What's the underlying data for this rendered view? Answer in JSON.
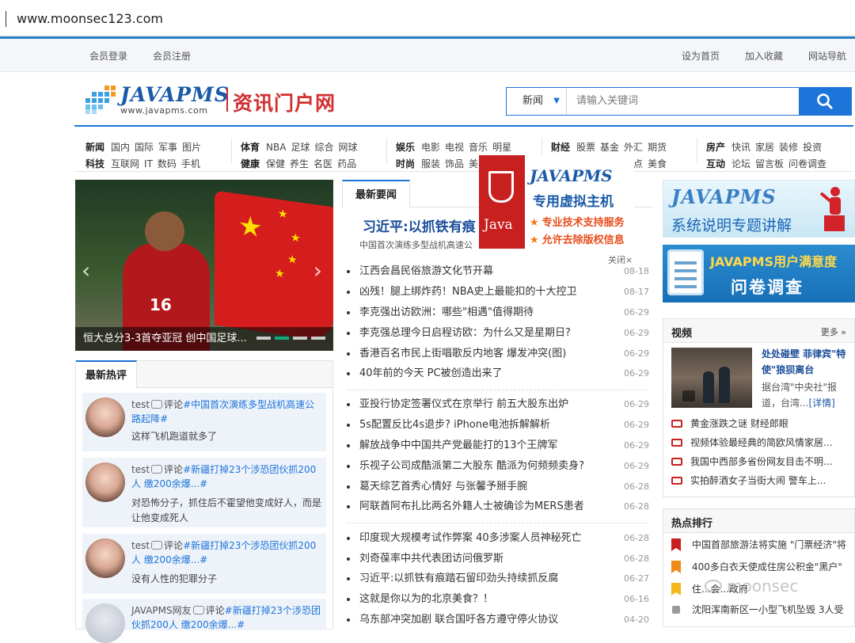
{
  "browser": {
    "url": "www.moonsec123.com"
  },
  "topbar": {
    "login": "会员登录",
    "register": "会员注册",
    "homepage": "设为首页",
    "favorite": "加入收藏",
    "sitenav": "网站导航"
  },
  "logo": {
    "brand": "JAVAPMS",
    "url": "www.javapms.com",
    "title": "资讯门户网"
  },
  "search": {
    "category": "新闻",
    "placeholder": "请输入关键词"
  },
  "nav": {
    "groups": [
      {
        "row1": {
          "head": "新闻",
          "items": [
            "国内",
            "国际",
            "军事",
            "图片"
          ]
        },
        "row2": {
          "head": "科技",
          "items": [
            "互联网",
            "IT",
            "数码",
            "手机"
          ]
        }
      },
      {
        "row1": {
          "head": "体育",
          "items": [
            "NBA",
            "足球",
            "综合",
            "网球"
          ]
        },
        "row2": {
          "head": "健康",
          "items": [
            "保健",
            "养生",
            "名医",
            "药品"
          ]
        }
      },
      {
        "row1": {
          "head": "娱乐",
          "items": [
            "电影",
            "电视",
            "音乐",
            "明星"
          ]
        },
        "row2": {
          "head": "时尚",
          "items": [
            "服装",
            "饰品",
            "美容",
            "美食"
          ]
        }
      },
      {
        "row1": {
          "head": "财经",
          "items": [
            "股票",
            "基金",
            "外汇",
            "期货"
          ]
        },
        "row2": {
          "head": "旅游",
          "items": [
            "游记",
            "户外",
            "景点",
            "美食"
          ]
        }
      },
      {
        "row1": {
          "head": "房产",
          "items": [
            "快讯",
            "家居",
            "装修",
            "投资"
          ]
        },
        "row2": {
          "head": "互动",
          "items": [
            "论坛",
            "留言板",
            "问卷调查"
          ]
        }
      }
    ]
  },
  "slider": {
    "caption": "恒大总分3-3首夺亚冠 创中国足球...",
    "jersey": "16"
  },
  "hot": {
    "title": "最新热评",
    "comments": [
      {
        "user": "test",
        "verb": "评论",
        "topic": "#中国首次演练多型战机高速公路起降#",
        "text": "这样飞机跑道就多了"
      },
      {
        "user": "test",
        "verb": "评论",
        "topic": "#新疆打掉23个涉恐团伙抓200人 缴200余爆...#",
        "text": "对恐怖分子，抓住后不霍望他变成好人，而是让他变成死人"
      },
      {
        "user": "test",
        "verb": "评论",
        "topic": "#新疆打掉23个涉恐团伙抓200人 缴200余爆...#",
        "text": "没有人性的犯罪分子"
      },
      {
        "user": "JAVAPMS网友",
        "verb": "评论",
        "topic": "#新疆打掉23个涉恐团伙抓200人 缴200余爆...#",
        "text": ""
      }
    ]
  },
  "news": {
    "tab": "最新要闻",
    "headline": "习近平:以抓铁有痕",
    "sub": "中国首次演练多型战机高速公",
    "group1": [
      {
        "title": "江西会昌民俗旅游文化节开幕",
        "date": "08-18"
      },
      {
        "title": "凶残！腿上绑炸药！NBA史上最能扣的十大控卫",
        "date": "08-17"
      },
      {
        "title": "李克强出访欧洲：哪些\"相遇\"值得期待",
        "date": "06-29"
      },
      {
        "title": "李克强总理今日启程访欧：为什么又是星期日?",
        "date": "06-29"
      },
      {
        "title": "香港百名市民上街唱歌反内地客 爆发冲突(图)",
        "date": "06-29"
      },
      {
        "title": "40年前的今天 PC被创造出来了",
        "date": "06-29"
      }
    ],
    "group2": [
      {
        "title": "亚投行协定签署仪式在京举行 前五大股东出炉",
        "date": "06-29"
      },
      {
        "title": "5s配置反比4s退步? iPhone电池拆解解析",
        "date": "06-29"
      },
      {
        "title": "解放战争中中国共产党最能打的13个王牌军",
        "date": "06-29"
      },
      {
        "title": "乐视子公司成酷派第二大股东 酷派为何频频卖身?",
        "date": "06-29"
      },
      {
        "title": "葛天综艺首秀心情好 与张馨予掰手腕",
        "date": "06-28"
      },
      {
        "title": "阿联酋阿布扎比两名外籍人士被确诊为MERS患者",
        "date": "06-28"
      }
    ],
    "group3": [
      {
        "title": "印度现大规模考试作弊案 40多涉案人员神秘死亡",
        "date": "06-28"
      },
      {
        "title": "刘奇葆率中共代表团访问俄罗斯",
        "date": "06-28"
      },
      {
        "title": "习近平:以抓铁有痕踏石留印劲头持续抓反腐",
        "date": "06-27"
      },
      {
        "title": "这就是你以为的北京美食？！",
        "date": "06-16"
      },
      {
        "title": "乌东部冲突加剧 联合国吁各方遵守停火协议",
        "date": "04-20"
      }
    ]
  },
  "popup_ad": {
    "java_label": "Java",
    "title": "JAVAPMS",
    "subtitle": "专用虚拟主机",
    "line1": "专业技术支持服务",
    "line2": "允许去除版权信息",
    "close": "关闭×"
  },
  "banner1": {
    "brand": "JAVAPMS",
    "text": "系统说明专题讲解"
  },
  "banner2": {
    "title": "JAVAPMS用户满意度",
    "text": "问卷调查"
  },
  "video": {
    "title": "视频",
    "more": "更多 »",
    "feature_title": "处处碰壁 菲律宾\"特使\"狼狈离台",
    "feature_desc": "据台湾\"中央社\"报道，台湾...",
    "detail": "[详情]",
    "items": [
      "黄金涨跌之谜 财经郎眼",
      "视频体验最经典的简欧风情家居...",
      "我国中西部多省份网友目击不明...",
      "实拍醉酒女子当街大闹 警车上..."
    ]
  },
  "ranking": {
    "title": "热点排行",
    "items": [
      "中国首部旅游法将实施 \"门票经济\"将",
      "400多白衣天使成住房公积金\"黑户\"",
      "住...会...政府",
      "沈阳浑南新区一小型飞机坠毁 3人受"
    ]
  },
  "watermark": "moonsec",
  "colors": {
    "accent": "#1d74d8",
    "brand_red": "#d23030",
    "link_blue": "#1a4c9a"
  }
}
